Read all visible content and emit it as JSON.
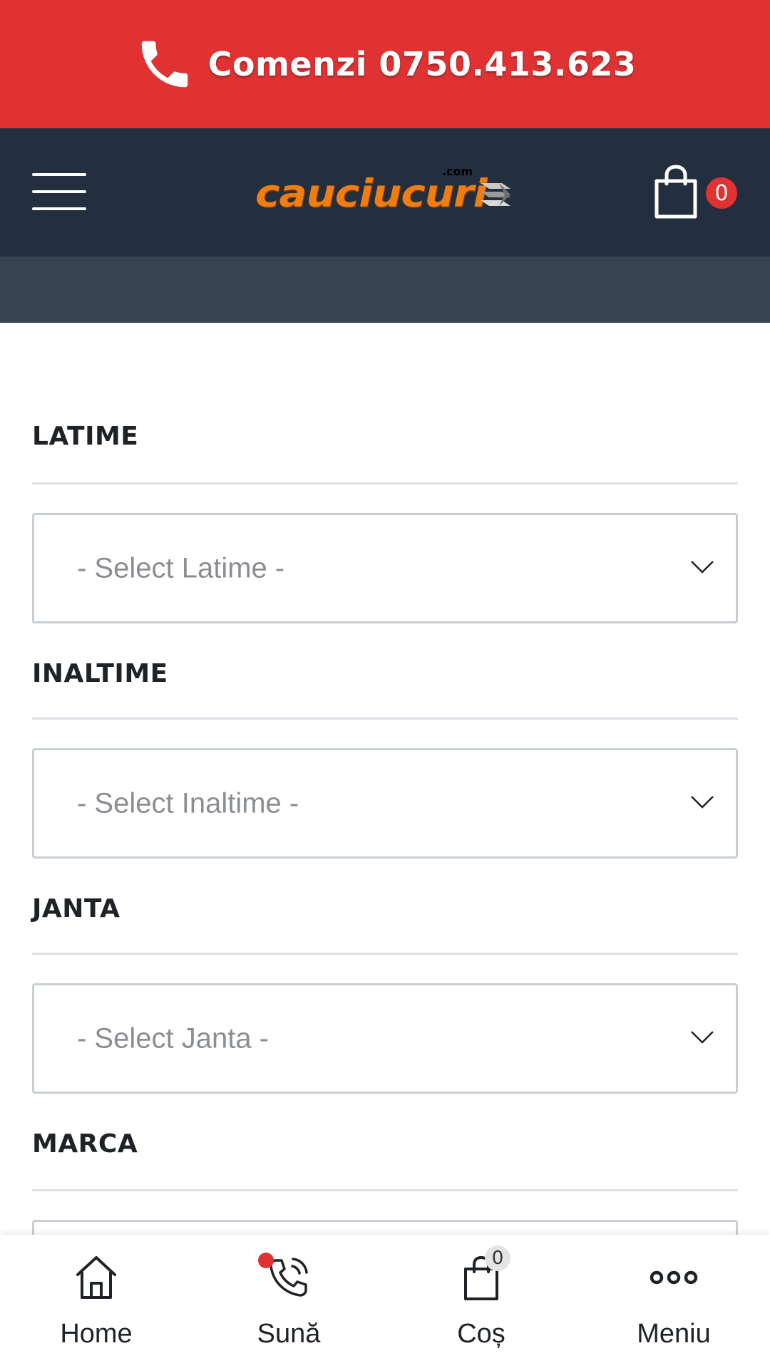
{
  "topbar": {
    "phone_label": "Comenzi 0750.413.623",
    "icon": "phone-icon",
    "bg_color": "#e03233"
  },
  "header": {
    "logo_text": "cauciucuri",
    "logo_suffix": ".com",
    "cart_count": "0",
    "bg_color": "#232f3f",
    "logo_color": "#f07d10"
  },
  "filters": [
    {
      "label": "LATIME",
      "placeholder": "- Select Latime -"
    },
    {
      "label": "INALTIME",
      "placeholder": "- Select Inaltime -"
    },
    {
      "label": "JANTA",
      "placeholder": "- Select Janta -"
    },
    {
      "label": "MARCA",
      "placeholder": ""
    }
  ],
  "bottom_nav": {
    "items": [
      {
        "label": "Home",
        "icon": "home-icon"
      },
      {
        "label": "Sună",
        "icon": "phone-call-icon"
      },
      {
        "label": "Coș",
        "icon": "shopping-bag-icon"
      },
      {
        "label": "Meniu",
        "icon": "more-dots-icon"
      }
    ],
    "cos_count": "0"
  }
}
